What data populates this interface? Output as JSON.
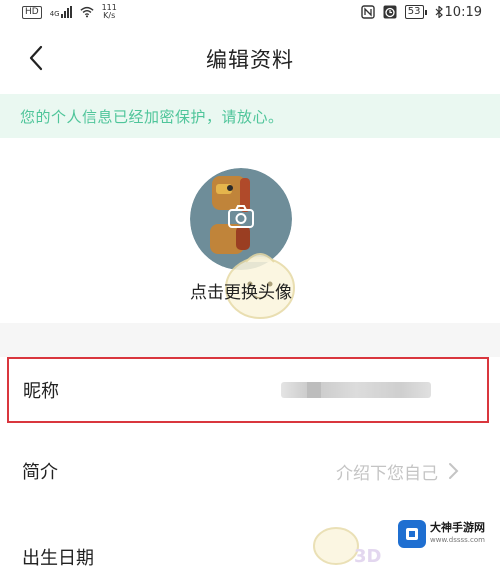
{
  "status_bar": {
    "hd": "HD",
    "network": "4G",
    "speed_value": "111",
    "speed_unit": "K/s",
    "battery": "53",
    "time": "10:19",
    "icons": [
      "hd-badge-icon",
      "signal-icon",
      "wifi-icon",
      "nfc-icon",
      "alarm-icon",
      "battery-icon",
      "bluetooth-icon"
    ]
  },
  "header": {
    "back_icon": "chevron-left-icon",
    "title": "编辑资料"
  },
  "notice": {
    "text": "您的个人信息已经加密保护，请放心。",
    "color": "#4fc59a",
    "background": "#eaf8f1"
  },
  "avatar": {
    "icon": "camera-icon",
    "change_label": "点击更换头像"
  },
  "profile": {
    "nickname": {
      "label": "昵称"
    },
    "intro": {
      "label": "简介",
      "placeholder": "介绍下您自己",
      "icon": "chevron-right-icon"
    },
    "birthday": {
      "label": "出生日期"
    }
  },
  "watermark": {
    "site_mark": "3D",
    "brand_name": "大神手游网",
    "brand_url": "www.dssss.com",
    "highlight_color": "#d9363e"
  }
}
